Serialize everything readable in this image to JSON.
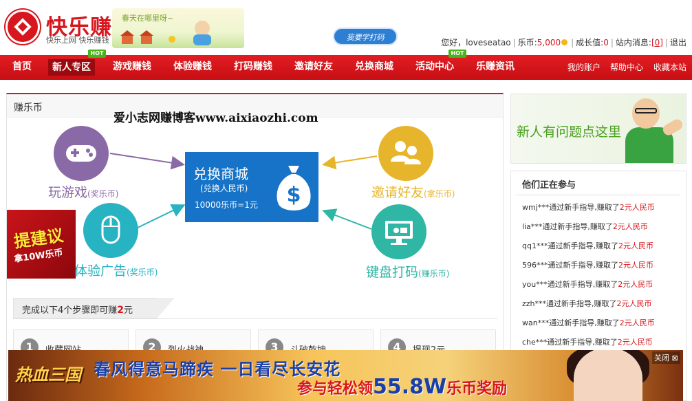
{
  "header": {
    "logo_name": "快乐赚",
    "logo_slogan": "快乐上网  快乐赚钱",
    "banner_text": "春天在哪里呀~",
    "learn_badge": "我要学打码",
    "user": {
      "greeting": "您好，loveseatao",
      "coins_label": "乐币:",
      "coins_value": "5,000",
      "growth_label": "成长值:",
      "growth_value": "0",
      "messages_label": "站内消息:",
      "messages_value": "[0]",
      "logout": "退出"
    }
  },
  "nav": {
    "items": [
      {
        "label": "首页"
      },
      {
        "label": "新人专区",
        "badge": "HOT"
      },
      {
        "label": "游戏赚钱"
      },
      {
        "label": "体验赚钱"
      },
      {
        "label": "打码赚钱"
      },
      {
        "label": "邀请好友"
      },
      {
        "label": "兑换商城"
      },
      {
        "label": "活动中心",
        "badge": "HOT"
      },
      {
        "label": "乐赚资讯"
      }
    ],
    "right": [
      "我的账户",
      "帮助中心",
      "收藏本站"
    ]
  },
  "main": {
    "title": "赚乐币",
    "watermark": "爱小志网赚博客www.aixiaozhi.com",
    "exchange": {
      "title": "兑换商城",
      "subtitle": "(兑换人民币)",
      "rate": "10000乐币=1元"
    },
    "methods": {
      "game": {
        "name": "玩游戏",
        "note": "(奖乐币)"
      },
      "ads": {
        "name": "体验广告",
        "note": "(奖乐币)"
      },
      "invite": {
        "name": "邀请好友",
        "note": "(拿乐币)"
      },
      "typing": {
        "name": "键盘打码",
        "note": "(赚乐币)"
      }
    },
    "suggest": {
      "line1": "提建议",
      "line2": "拿10W乐币"
    },
    "steps_intro": {
      "prefix": "完成以下4个步骤即可赚",
      "amount": "2",
      "suffix": "元"
    },
    "steps": [
      {
        "num": "1",
        "label": "收藏网站"
      },
      {
        "num": "2",
        "label": "烈火战神"
      },
      {
        "num": "3",
        "label": "斗破乾坤"
      },
      {
        "num": "4",
        "label": "提现2元"
      }
    ]
  },
  "sidebar": {
    "newbie": "新人有问题点这里",
    "activity_title": "他们正在参与",
    "activity": [
      {
        "user": "wmj***",
        "action": "通过新手指导,赚取了",
        "reward": "2元人民币"
      },
      {
        "user": "lia***",
        "action": "通过新手指导,赚取了",
        "reward": "2元人民币"
      },
      {
        "user": "qq1***",
        "action": "通过新手指导,赚取了",
        "reward": "2元人民币"
      },
      {
        "user": "596***",
        "action": "通过新手指导,赚取了",
        "reward": "2元人民币"
      },
      {
        "user": "you***",
        "action": "通过新手指导,赚取了",
        "reward": "2元人民币"
      },
      {
        "user": "zzh***",
        "action": "通过新手指导,赚取了",
        "reward": "2元人民币"
      },
      {
        "user": "wan***",
        "action": "通过新手指导,赚取了",
        "reward": "2元人民币"
      },
      {
        "user": "che***",
        "action": "通过新手指导,赚取了",
        "reward": "2元人民币"
      }
    ]
  },
  "ad": {
    "logo": "热血三国",
    "line1": "春风得意马蹄疾  一日看尽长安花",
    "line2_prefix": "参与轻松领",
    "line2_amount": "55.8W",
    "line2_suffix": "乐币奖励",
    "close": "关闭"
  },
  "colors": {
    "brand_red": "#d7161d",
    "nav_red": "#c80f14",
    "hot_green": "#4ab21b",
    "exchange_blue": "#1673c8",
    "game_purple": "#8a6aa6",
    "ads_teal": "#28b3c2",
    "invite_gold": "#e7b52b",
    "typing_teal": "#2fb6a4"
  },
  "icons": {
    "logo": "logo-diamond-icon",
    "game": "gamepad-icon",
    "ads": "mouse-icon",
    "invite": "users-icon",
    "typing": "monitor-icon",
    "exchange": "moneybag-icon",
    "coin": "coin-icon"
  }
}
